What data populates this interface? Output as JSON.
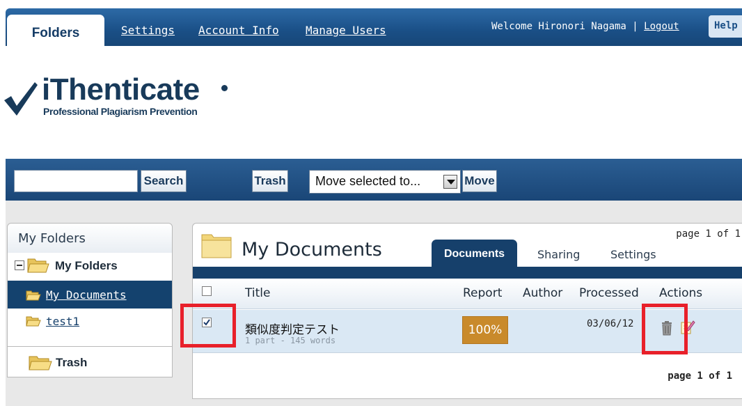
{
  "topnav": {
    "tabs": [
      {
        "label": "Folders",
        "active": true
      },
      {
        "label": "Settings"
      },
      {
        "label": "Account Info"
      },
      {
        "label": "Manage Users"
      }
    ],
    "welcome_text": "Welcome Hironori Nagama | ",
    "logout_label": "Logout",
    "help_label": "Help"
  },
  "logo": {
    "name": "iThenticate",
    "tagline": "Professional Plagiarism Prevention",
    "icon": "checkmark-icon"
  },
  "toolbar": {
    "search_value": "",
    "search_button": "Search",
    "trash_button": "Trash",
    "move_select_value": "Move selected to...",
    "move_button": "Move"
  },
  "folders_panel": {
    "title": "My Folders",
    "root_label": "My Folders",
    "items": [
      {
        "label": "My Documents",
        "selected": true
      },
      {
        "label": "test1",
        "selected": false
      }
    ],
    "trash_label": "Trash"
  },
  "documents_panel": {
    "title": "My Documents",
    "page_info_top": "page 1 of 1",
    "tabs": [
      {
        "label": "Documents",
        "active": true
      },
      {
        "label": "Sharing"
      },
      {
        "label": "Settings"
      }
    ],
    "columns": [
      "Title",
      "Report",
      "Author",
      "Processed",
      "Actions"
    ],
    "rows": [
      {
        "checked": true,
        "title": "類似度判定テスト",
        "meta": "1 part - 145 words",
        "report": "100%",
        "author": "",
        "processed": "03/06/12",
        "actions": [
          "trash-icon",
          "edit-icon"
        ]
      }
    ],
    "page_info_bottom": "page 1 of 1"
  },
  "colors": {
    "nav_blue": "#1a4f86",
    "selected_row": "#14426e",
    "report_badge": "#c98a2b",
    "highlight_red": "#e8202a",
    "row_bg": "#dae8f4"
  }
}
